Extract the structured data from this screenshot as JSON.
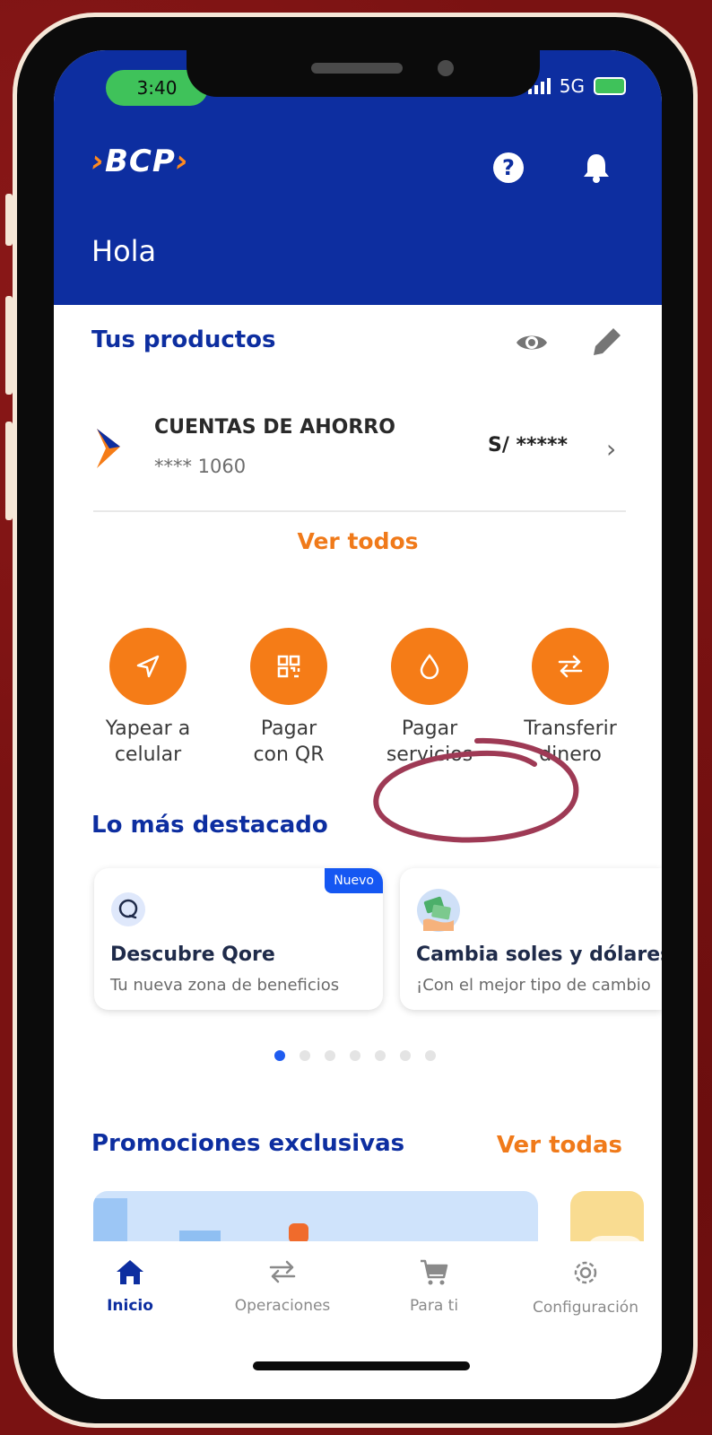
{
  "status_bar": {
    "time": "3:40",
    "network": "5G"
  },
  "header": {
    "brand": "BCP",
    "greeting": "Hola"
  },
  "products": {
    "title": "Tus productos",
    "account": {
      "name": "CUENTAS DE AHORRO",
      "number": "**** 1060",
      "balance": "S/ *****"
    },
    "view_all": "Ver todos"
  },
  "quick_actions": [
    {
      "line1": "Yapear a",
      "line2": "celular",
      "icon": "send-icon"
    },
    {
      "line1": "Pagar",
      "line2": "con QR",
      "icon": "qr-icon"
    },
    {
      "line1": "Pagar",
      "line2": "servicios",
      "icon": "drop-icon"
    },
    {
      "line1": "Transferir",
      "line2": "dinero",
      "icon": "transfer-icon"
    }
  ],
  "highlights": {
    "title": "Lo más destacado",
    "cards": [
      {
        "badge": "Nuevo",
        "title": "Descubre Qore",
        "subtitle": "Tu nueva zona de beneficios"
      },
      {
        "title": "Cambia soles y dólares",
        "subtitle": "¡Con el mejor tipo de cambio"
      }
    ],
    "page_count": 7,
    "active_page": 1
  },
  "promotions": {
    "title": "Promociones exclusivas",
    "link": "Ver todas"
  },
  "tabbar": {
    "tabs": [
      {
        "label": "Inicio",
        "icon": "home-icon",
        "active": true
      },
      {
        "label": "Operaciones",
        "icon": "swap-icon",
        "active": false
      },
      {
        "label": "Para ti",
        "icon": "cart-icon",
        "active": false
      },
      {
        "label": "Configuración",
        "icon": "gear-icon",
        "active": false
      }
    ]
  },
  "colors": {
    "brand_blue": "#0d2ea0",
    "accent_orange": "#f57c17",
    "annotation": "#9e3a55"
  }
}
